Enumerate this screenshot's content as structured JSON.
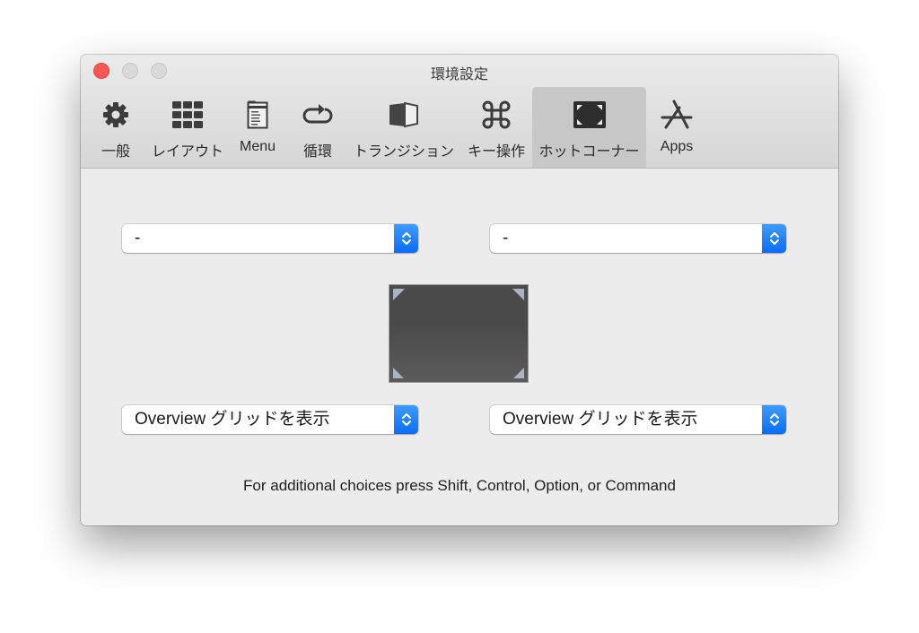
{
  "window": {
    "title": "環境設定"
  },
  "toolbar": {
    "items": [
      {
        "label": "一般",
        "icon": "gear-icon"
      },
      {
        "label": "レイアウト",
        "icon": "grid-icon"
      },
      {
        "label": "Menu",
        "icon": "menu-window-icon"
      },
      {
        "label": "循環",
        "icon": "cycle-arrow-icon"
      },
      {
        "label": "トランジション",
        "icon": "transition-cube-icon"
      },
      {
        "label": "キー操作",
        "icon": "command-key-icon"
      },
      {
        "label": "ホットコーナー",
        "icon": "hot-corners-icon"
      },
      {
        "label": "Apps",
        "icon": "app-store-icon"
      }
    ],
    "selected_index": 6
  },
  "hot_corners": {
    "top_left": {
      "value": "-"
    },
    "top_right": {
      "value": "-"
    },
    "bottom_left": {
      "value": "Overview グリッドを表示"
    },
    "bottom_right": {
      "value": "Overview グリッドを表示"
    }
  },
  "hint": "For additional choices press Shift, Control, Option, or Command",
  "colors": {
    "accent": "#1a7cf9",
    "close": "#fc5753",
    "selected_tab_bg": "#c7c7c7"
  }
}
